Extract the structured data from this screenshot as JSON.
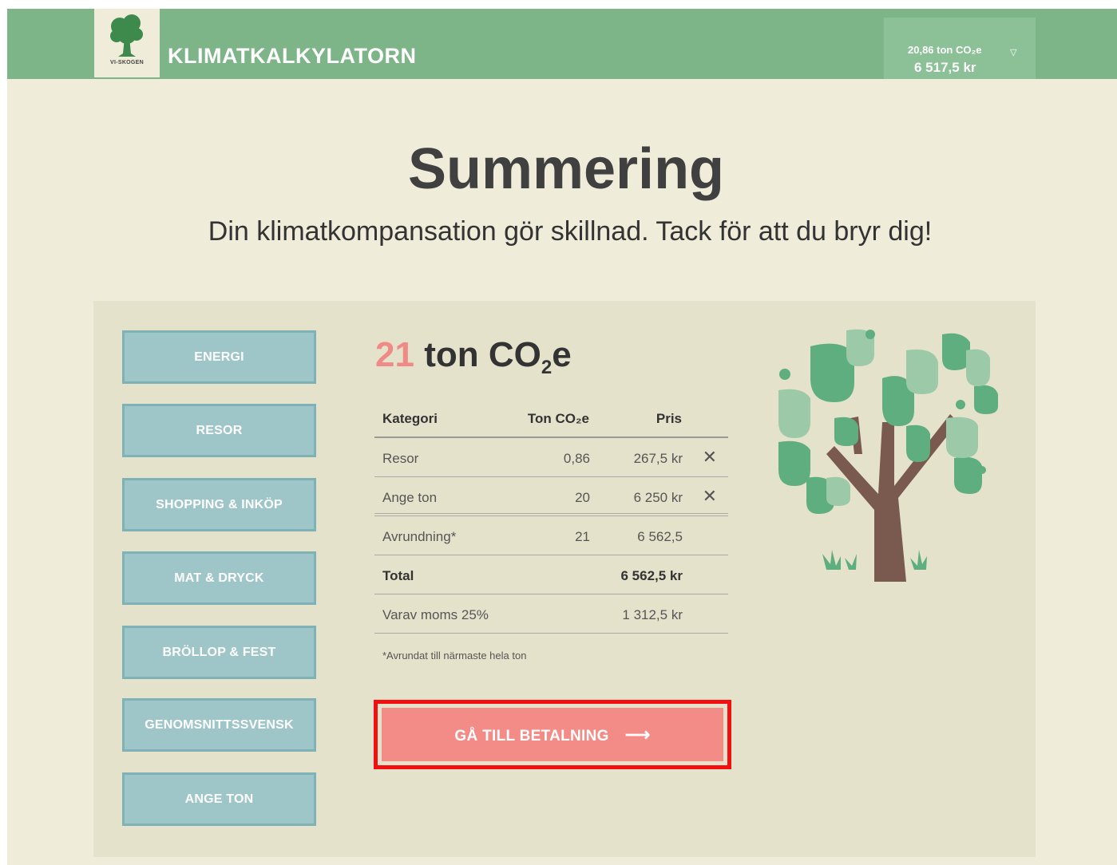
{
  "header": {
    "logo_text": "VI-SKOGEN",
    "app_title": "KLIMATKALKYLATORN",
    "cart": {
      "co2": "20,86 ton CO₂e",
      "price": "6 517,5 kr",
      "caret": "▽"
    }
  },
  "page": {
    "title": "Summering",
    "subtitle": "Din klimatkompansation gör skillnad. Tack för att du bryr dig!"
  },
  "categories": [
    "ENERGI",
    "RESOR",
    "SHOPPING & INKÖP",
    "MAT & DRYCK",
    "BRÖLLOP & FEST",
    "GENOMSNITTSSVENSK",
    "ANGE TON"
  ],
  "summary": {
    "total_number": "21",
    "total_unit_prefix": "ton CO",
    "total_unit_sub": "2",
    "total_unit_suffix": "e",
    "columns": {
      "category": "Kategori",
      "ton": "Ton CO₂e",
      "price": "Pris"
    },
    "rows": [
      {
        "category": "Resor",
        "ton": "0,86",
        "price": "267,5 kr",
        "delete": "✕"
      },
      {
        "category": "Ange ton",
        "ton": "20",
        "price": "6 250 kr",
        "delete": "✕"
      }
    ],
    "rounding": {
      "label": "Avrundning*",
      "ton": "21",
      "price": "6 562,5"
    },
    "total": {
      "label": "Total",
      "price": "6 562,5 kr"
    },
    "vat": {
      "label": "Varav moms 25%",
      "price": "1 312,5 kr"
    },
    "footnote": "*Avrundat till närmaste hela ton"
  },
  "pay_button": {
    "label": "GÅ TILL BETALNING",
    "arrow": "⟶"
  },
  "colors": {
    "header_green": "#7db589",
    "accent_red": "#f38c87",
    "button_teal": "#9ec6c9",
    "tree_trunk": "#7a5a4e"
  }
}
